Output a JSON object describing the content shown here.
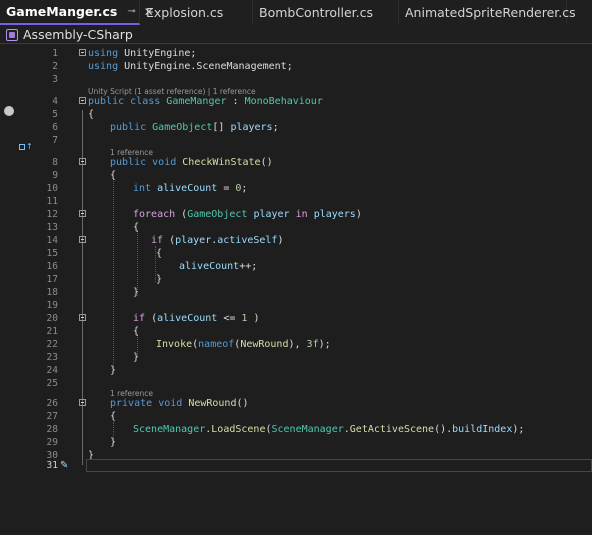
{
  "tabs": [
    {
      "label": "GameManger.cs",
      "active": true,
      "pin_icon": "pin-icon",
      "close_icon": "close-icon"
    },
    {
      "label": "Explosion.cs"
    },
    {
      "label": "BombController.cs"
    },
    {
      "label": "AnimatedSpriteRenderer.cs"
    }
  ],
  "project": {
    "label": "Assembly-CSharp",
    "icon": "csharp-project-icon"
  },
  "editor": {
    "current_line": "31",
    "lenses": {
      "class": "Unity Script (1 asset reference) | 1 reference",
      "checkwin": "1 reference",
      "newround": "1 reference"
    },
    "line_numbers": [
      "1",
      "2",
      "3",
      "4",
      "5",
      "6",
      "7",
      "8",
      "9",
      "10",
      "11",
      "12",
      "13",
      "14",
      "15",
      "16",
      "17",
      "18",
      "19",
      "20",
      "21",
      "22",
      "23",
      "24",
      "25",
      "26",
      "27",
      "28",
      "29",
      "30",
      "31"
    ],
    "code": {
      "l1": [
        "using",
        " UnityEngine;"
      ],
      "l2": [
        "using",
        " UnityEngine",
        ".",
        "SceneManagement",
        ";"
      ],
      "l4": [
        "public",
        " ",
        "class",
        " ",
        "GameManger",
        " : ",
        "MonoBehaviour"
      ],
      "l5": [
        "{"
      ],
      "l6": [
        "public",
        " ",
        "GameObject",
        "[] ",
        "players",
        ";"
      ],
      "l8": [
        "public",
        " ",
        "void",
        " ",
        "CheckWinState",
        "()"
      ],
      "l9": [
        "{"
      ],
      "l10": [
        "int",
        " ",
        "aliveCount",
        " = ",
        "0",
        ";"
      ],
      "l12": [
        "foreach",
        " (",
        "GameObject",
        " ",
        "player",
        " ",
        "in",
        " ",
        "players",
        ")"
      ],
      "l13": [
        "{"
      ],
      "l14": [
        "if",
        " (",
        "player",
        ".",
        "activeSelf",
        ")"
      ],
      "l15": [
        "{"
      ],
      "l16": [
        "aliveCount",
        "++;"
      ],
      "l17": [
        "}"
      ],
      "l18": [
        "}"
      ],
      "l20": [
        "if",
        " (",
        "aliveCount",
        " <= ",
        "1",
        " )"
      ],
      "l21": [
        "{"
      ],
      "l22": [
        "Invoke",
        "(",
        "nameof",
        "(",
        "NewRound",
        "), ",
        "3f",
        ");"
      ],
      "l23": [
        "}"
      ],
      "l24": [
        "}"
      ],
      "l26": [
        "private",
        " ",
        "void",
        " ",
        "NewRound",
        "()"
      ],
      "l27": [
        "{"
      ],
      "l28": [
        "SceneManager",
        ".",
        "LoadScene",
        "(",
        "SceneManager",
        ".",
        "GetActiveScene",
        "().",
        "buildIndex",
        ");"
      ],
      "l29": [
        "}"
      ],
      "l30": [
        "}"
      ]
    }
  },
  "colors": {
    "keyword": "#569cd6",
    "type": "#4ec9b0",
    "method": "#dcdcaa",
    "variable": "#9cdcfe",
    "number": "#b5cea8",
    "control": "#d8a0df",
    "active_tab_underline": "#7160e8"
  }
}
